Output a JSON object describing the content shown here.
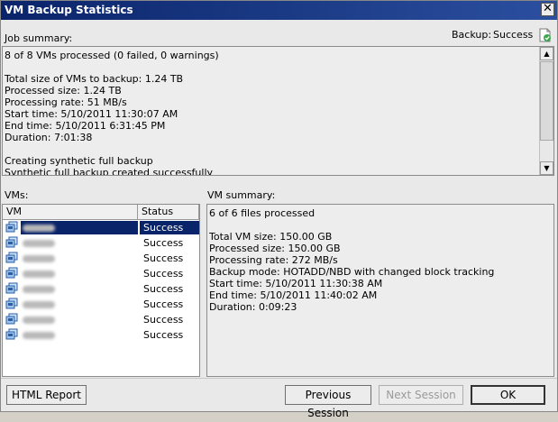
{
  "window": {
    "title": "VM Backup Statistics",
    "close_label": "✕"
  },
  "job": {
    "label": "Job summary:",
    "backup_label": "Backup:",
    "backup_status": "Success",
    "lines": [
      "8 of 8 VMs processed (0 failed, 0 warnings)",
      "",
      "Total size of VMs to backup: 1.24 TB",
      "Processed size: 1.24 TB",
      "Processing rate: 51 MB/s",
      "Start time: 5/10/2011 11:30:07 AM",
      "End time: 5/10/2011 6:31:45 PM",
      "Duration: 7:01:38",
      "",
      "Creating synthetic full backup",
      "Synthetic full backup created successfully"
    ]
  },
  "vms": {
    "label": "VMs:",
    "columns": [
      "VM",
      "Status"
    ],
    "rows": [
      {
        "status": "Success",
        "selected": true
      },
      {
        "status": "Success"
      },
      {
        "status": "Success"
      },
      {
        "status": "Success"
      },
      {
        "status": "Success"
      },
      {
        "status": "Success"
      },
      {
        "status": "Success"
      },
      {
        "status": "Success"
      }
    ]
  },
  "vm_summary": {
    "label": "VM summary:",
    "lines": [
      "6 of 6 files processed",
      "",
      "Total VM size: 150.00 GB",
      "Processed size: 150.00 GB",
      "Processing rate: 272 MB/s",
      "Backup mode: HOTADD/NBD with changed block tracking",
      "Start time: 5/10/2011 11:30:38 AM",
      "End time: 5/10/2011 11:40:02 AM",
      "Duration: 0:09:23"
    ]
  },
  "buttons": {
    "html_report": "HTML Report",
    "previous_session": "Previous Session",
    "next_session": "Next Session",
    "ok": "OK"
  },
  "colors": {
    "selection": "#0a246a",
    "titlebar": "#0a246a"
  }
}
